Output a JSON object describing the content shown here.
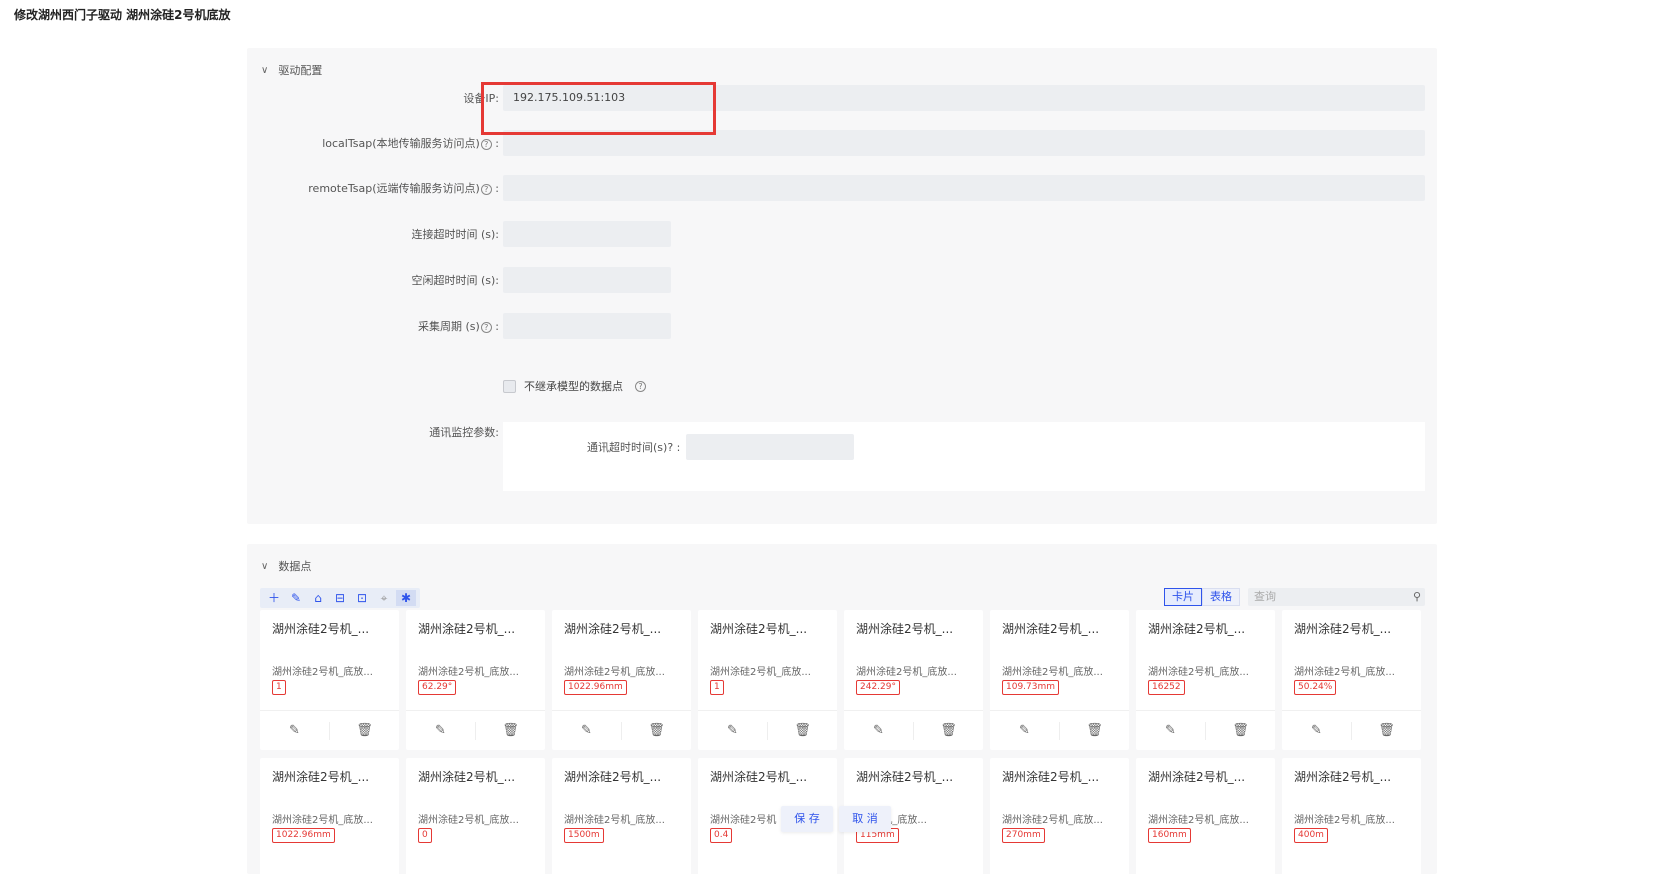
{
  "page": {
    "title": "修改湖州西门子驱动 湖州涂硅2号机底放"
  },
  "driver": {
    "section_title": "驱动配置",
    "fields": [
      {
        "label": "设备IP:",
        "value": "192.175.109.51:103"
      },
      {
        "label": "localTsap(本地传输服务访问点)",
        "value": ""
      },
      {
        "label": "remoteTsap(远端传输服务访问点)",
        "value": ""
      },
      {
        "label": "连接超时时间 (s):",
        "value": ""
      },
      {
        "label": "空闲超时时间 (s):",
        "value": ""
      },
      {
        "label": "采集周期 (s)",
        "value": ""
      }
    ],
    "checkbox_label": "不继承模型的数据点",
    "monitor_label": "通讯监控参数:",
    "monitor_timeout_label": "通讯超时时间(s)",
    "monitor_timeout_value": ""
  },
  "points": {
    "section_title": "数据点",
    "view_card": "卡片",
    "view_table": "表格",
    "search_placeholder": "查询",
    "cards": [
      {
        "title": "湖州涂硅2号机_...",
        "sub": "湖州涂硅2号机_底放...",
        "value": "1"
      },
      {
        "title": "湖州涂硅2号机_...",
        "sub": "湖州涂硅2号机_底放...",
        "value": "62.29°"
      },
      {
        "title": "湖州涂硅2号机_...",
        "sub": "湖州涂硅2号机_底放...",
        "value": "1022.96mm"
      },
      {
        "title": "湖州涂硅2号机_...",
        "sub": "湖州涂硅2号机_底放...",
        "value": "1"
      },
      {
        "title": "湖州涂硅2号机_...",
        "sub": "湖州涂硅2号机_底放...",
        "value": "242.29°"
      },
      {
        "title": "湖州涂硅2号机_...",
        "sub": "湖州涂硅2号机_底放...",
        "value": "109.73mm"
      },
      {
        "title": "湖州涂硅2号机_...",
        "sub": "湖州涂硅2号机_底放...",
        "value": "16252"
      },
      {
        "title": "湖州涂硅2号机_...",
        "sub": "湖州涂硅2号机_底放...",
        "value": "50.24%"
      },
      {
        "title": "湖州涂硅2号机_...",
        "sub": "湖州涂硅2号机_底放...",
        "value": "1022.96mm"
      },
      {
        "title": "湖州涂硅2号机_...",
        "sub": "湖州涂硅2号机_底放...",
        "value": "0"
      },
      {
        "title": "湖州涂硅2号机_...",
        "sub": "湖州涂硅2号机_底放...",
        "value": "1500m"
      },
      {
        "title": "湖州涂硅2号机_...",
        "sub": "湖州涂硅2号机",
        "value": "0.4"
      },
      {
        "title": "湖州涂硅2号机_...",
        "sub": "硅2号机_底放...",
        "value": "115mm"
      },
      {
        "title": "湖州涂硅2号机_...",
        "sub": "湖州涂硅2号机_底放...",
        "value": "270mm"
      },
      {
        "title": "湖州涂硅2号机_...",
        "sub": "湖州涂硅2号机_底放...",
        "value": "160mm"
      },
      {
        "title": "湖州涂硅2号机_...",
        "sub": "湖州涂硅2号机_底放...",
        "value": "400m"
      }
    ]
  },
  "actions": {
    "save": "保 存",
    "cancel": "取 消"
  },
  "icons": {
    "toolbar": [
      "plus-icon",
      "edit-icon",
      "bank-icon",
      "import-icon",
      "export-icon",
      "locate-icon",
      "debug-icon"
    ],
    "card_actions": [
      "edit-icon",
      "delete-icon"
    ],
    "search": "search-icon",
    "collapse": "chevron-down-icon"
  },
  "colors": {
    "accent": "#2f54eb",
    "value_tag": "#e53935",
    "highlight": "#e53935"
  }
}
